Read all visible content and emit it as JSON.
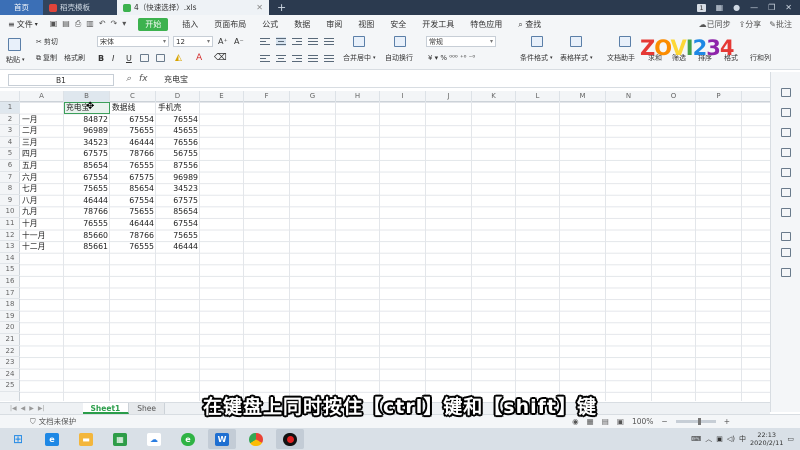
{
  "titlebar": {
    "tabs": [
      {
        "label": "首页"
      },
      {
        "label": "稻壳模板"
      },
      {
        "label": "4（快速选择）.xls"
      }
    ],
    "add_tab": "+",
    "badge": "1"
  },
  "menubar": {
    "file": "文件",
    "items": [
      "开始",
      "插入",
      "页面布局",
      "公式",
      "数据",
      "审阅",
      "视图",
      "安全",
      "开发工具",
      "特色应用"
    ],
    "search": "查找",
    "sync": "已同步",
    "share": "分享",
    "comment": "批注"
  },
  "toolbar": {
    "cut": "剪切",
    "paste": "粘贴",
    "copy": "复制",
    "format_painter": "格式刷",
    "font": "宋体",
    "font_size": "12",
    "number_format": "常规",
    "merge_center": "合并居中",
    "wrap": "自动换行",
    "conditional_format": "条件格式",
    "table_style": "表格样式",
    "doc_assistant": "文档助手",
    "sum": "求和",
    "filter": "筛选",
    "sort": "排序",
    "format": "格式",
    "rows_cols": "行和列"
  },
  "logo": {
    "text": "ZOVI234",
    "colors": [
      "#e53935",
      "#fb8c00",
      "#fdd835",
      "#43a047",
      "#1e88e5",
      "#8e24aa",
      "#e53935"
    ]
  },
  "formula_bar": {
    "cell_ref": "B1",
    "fx_label": "fx",
    "content": "充电宝"
  },
  "grid": {
    "columns": [
      "A",
      "B",
      "C",
      "D",
      "E",
      "F",
      "G",
      "H",
      "I",
      "J",
      "K",
      "L",
      "M",
      "N",
      "O",
      "P"
    ],
    "row_numbers": [
      "1",
      "2",
      "3",
      "4",
      "5",
      "6",
      "7",
      "8",
      "9",
      "10",
      "11",
      "12",
      "13",
      "14",
      "15",
      "16",
      "17",
      "18",
      "19",
      "20",
      "21",
      "22",
      "23",
      "24",
      "25"
    ],
    "headers": [
      "充电宝",
      "数据线",
      "手机壳"
    ],
    "rows": [
      {
        "label": "一月",
        "values": [
          "84872",
          "67554",
          "76554"
        ]
      },
      {
        "label": "二月",
        "values": [
          "96989",
          "75655",
          "45655"
        ]
      },
      {
        "label": "三月",
        "values": [
          "34523",
          "46444",
          "76556"
        ]
      },
      {
        "label": "四月",
        "values": [
          "67575",
          "78766",
          "56755"
        ]
      },
      {
        "label": "五月",
        "values": [
          "85654",
          "76555",
          "87556"
        ]
      },
      {
        "label": "六月",
        "values": [
          "67554",
          "67575",
          "96989"
        ]
      },
      {
        "label": "七月",
        "values": [
          "75655",
          "85654",
          "34523"
        ]
      },
      {
        "label": "八月",
        "values": [
          "46444",
          "67554",
          "67575"
        ]
      },
      {
        "label": "九月",
        "values": [
          "78766",
          "75655",
          "85654"
        ]
      },
      {
        "label": "十月",
        "values": [
          "76555",
          "46444",
          "67554"
        ]
      },
      {
        "label": "十一月",
        "values": [
          "85660",
          "78766",
          "75655"
        ]
      },
      {
        "label": "十二月",
        "values": [
          "85661",
          "76555",
          "46444"
        ]
      }
    ]
  },
  "sheet_tabs": {
    "tabs": [
      "Sheet1",
      "Shee"
    ]
  },
  "status": {
    "protect": "文档未保护",
    "zoom": "100%"
  },
  "subtitle": "在键盘上同时按住【ctrl】键和【shift】键",
  "taskbar": {
    "clock_time": "22:13",
    "clock_date": "2020/2/11",
    "ime": "中"
  }
}
